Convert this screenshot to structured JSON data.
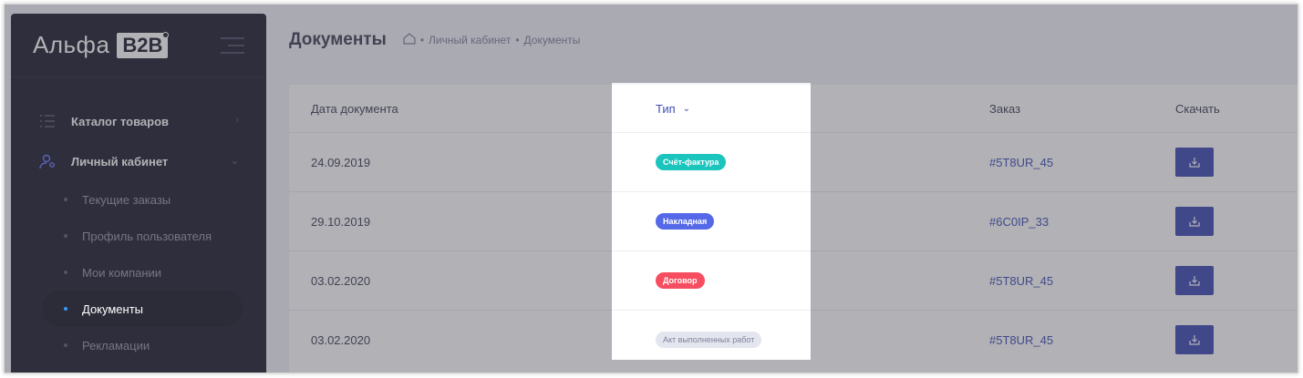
{
  "logo": {
    "text": "Альфа",
    "badge": "B2B"
  },
  "sidebar": {
    "sections": [
      {
        "label": "Каталог товаров",
        "icon": "list-icon"
      },
      {
        "label": "Личный кабинет",
        "icon": "user-settings-icon"
      }
    ],
    "sub_items": [
      {
        "label": "Текущие заказы"
      },
      {
        "label": "Профиль пользователя"
      },
      {
        "label": "Мои компании"
      },
      {
        "label": "Документы"
      },
      {
        "label": "Рекламации"
      }
    ]
  },
  "header": {
    "title": "Документы",
    "breadcrumb": [
      "Личный кабинет",
      "Документы"
    ]
  },
  "table": {
    "columns": {
      "date": "Дата документа",
      "type": "Тип",
      "order": "Заказ",
      "download": "Скачать"
    },
    "rows": [
      {
        "date": "24.09.2019",
        "type": "Счёт-фактура",
        "type_color": "#1bc5bd",
        "order": "#5T8UR_45"
      },
      {
        "date": "29.10.2019",
        "type": "Накладная",
        "type_color": "#5468e8",
        "order": "#6C0IP_33"
      },
      {
        "date": "03.02.2020",
        "type": "Договор",
        "type_color": "#f64e60",
        "order": "#5T8UR_45"
      },
      {
        "date": "03.02.2020",
        "type": "Акт выполненных работ",
        "type_color": "#e4e6ef",
        "order": "#5T8UR_45"
      }
    ]
  },
  "colors": {
    "sidebar_bg": "#1e1e2d",
    "accent": "#3f4bb2"
  }
}
